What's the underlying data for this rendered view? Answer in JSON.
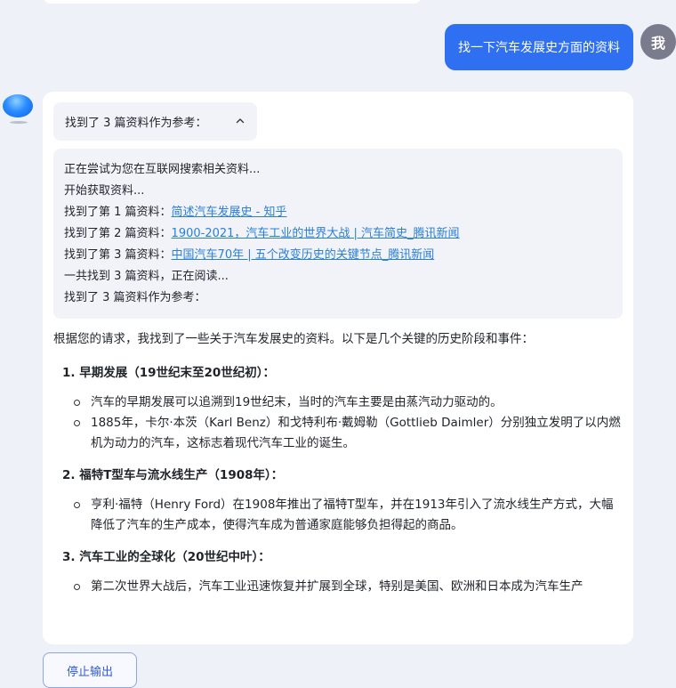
{
  "user_message": "找一下汽车发展史方面的资料",
  "user_avatar_label": "我",
  "references_toggle": "找到了 3 篇资料作为参考：",
  "search_log": {
    "line1": "正在尝试为您在互联网搜索相关资料...",
    "line2": "开始获取资料...",
    "refs": [
      {
        "prefix": "找到了第 1 篇资料：",
        "title": "简述汽车发展史 - 知乎"
      },
      {
        "prefix": "找到了第 2 篇资料：",
        "title": "1900-2021，汽车工业的世界大战 | 汽车简史_腾讯新闻"
      },
      {
        "prefix": "找到了第 3 篇资料：",
        "title": "中国汽车70年 | 五个改变历史的关键节点_腾讯新闻"
      }
    ],
    "line_total": "一共找到 3 篇资料，正在阅读...",
    "line_final": "找到了 3 篇资料作为参考："
  },
  "answer": {
    "intro": "根据您的请求，我找到了一些关于汽车发展史的资料。以下是几个关键的历史阶段和事件：",
    "sections": [
      {
        "title": "1. 早期发展（19世纪末至20世纪初）：",
        "bullets": [
          "汽车的早期发展可以追溯到19世纪末，当时的汽车主要是由蒸汽动力驱动的。",
          "1885年，卡尔·本茨（Karl Benz）和戈特利布·戴姆勒（Gottlieb Daimler）分别独立发明了以内燃机为动力的汽车，这标志着现代汽车工业的诞生。"
        ]
      },
      {
        "title": "2. 福特T型车与流水线生产（1908年）：",
        "bullets": [
          "亨利·福特（Henry Ford）在1908年推出了福特T型车，并在1913年引入了流水线生产方式，大幅降低了汽车的生产成本，使得汽车成为普通家庭能够负担得起的商品。"
        ]
      },
      {
        "title": "3. 汽车工业的全球化（20世纪中叶）：",
        "bullets": [
          "第二次世界大战后，汽车工业迅速恢复并扩展到全球，特别是美国、欧洲和日本成为汽车生产"
        ]
      }
    ]
  },
  "stop_button": "停止输出",
  "colors": {
    "background": "#eef1f8",
    "user_bubble": "#2f6ff2",
    "link": "#2a7fd4",
    "panel": "#f1f3f9"
  }
}
